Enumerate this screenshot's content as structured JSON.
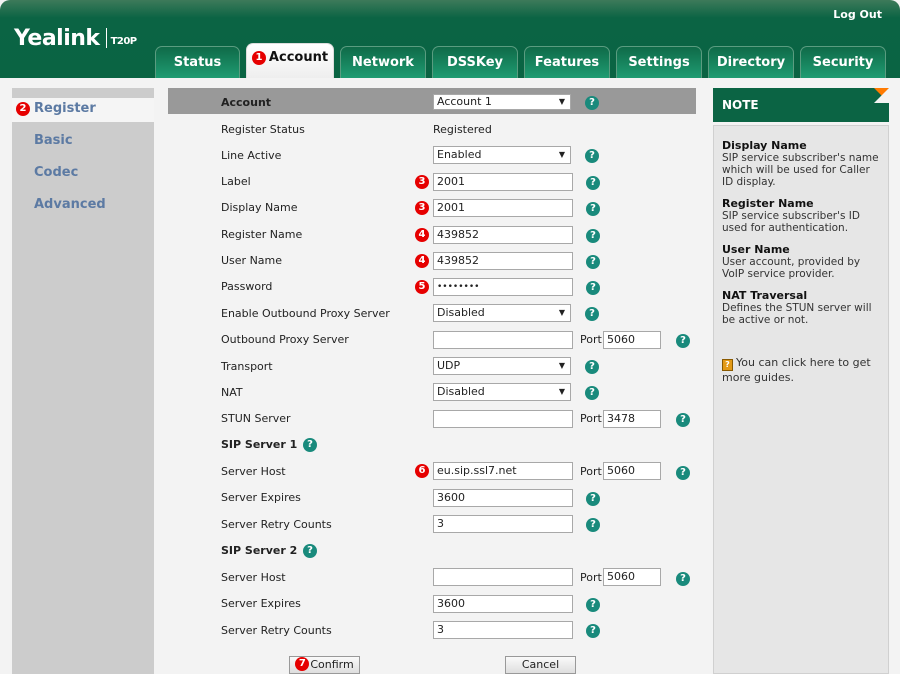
{
  "header": {
    "brand": "Yealink",
    "model": "T20P",
    "logout": "Log Out",
    "tabs": [
      {
        "label": "Status",
        "active": false
      },
      {
        "label": "Account",
        "active": true,
        "badge": "1"
      },
      {
        "label": "Network",
        "active": false
      },
      {
        "label": "DSSKey",
        "active": false
      },
      {
        "label": "Features",
        "active": false
      },
      {
        "label": "Settings",
        "active": false
      },
      {
        "label": "Directory",
        "active": false
      },
      {
        "label": "Security",
        "active": false
      }
    ]
  },
  "sidebar": {
    "items": [
      {
        "label": "Register",
        "active": true,
        "badge": "2"
      },
      {
        "label": "Basic",
        "active": false
      },
      {
        "label": "Codec",
        "active": false
      },
      {
        "label": "Advanced",
        "active": false
      }
    ]
  },
  "form": {
    "account": {
      "label": "Account",
      "value": "Account 1"
    },
    "register_status": {
      "label": "Register Status",
      "value": "Registered"
    },
    "line_active": {
      "label": "Line Active",
      "value": "Enabled"
    },
    "label": {
      "label": "Label",
      "value": "2001",
      "badge": "3"
    },
    "display_name": {
      "label": "Display Name",
      "value": "2001",
      "badge": "3"
    },
    "register_name": {
      "label": "Register Name",
      "value": "439852",
      "badge": "4"
    },
    "user_name": {
      "label": "User Name",
      "value": "439852",
      "badge": "4"
    },
    "password": {
      "label": "Password",
      "value": "••••••••",
      "badge": "5"
    },
    "enable_outbound": {
      "label": "Enable Outbound Proxy Server",
      "value": "Disabled"
    },
    "outbound_proxy": {
      "label": "Outbound Proxy Server",
      "value": "",
      "port_label": "Port",
      "port": "5060"
    },
    "transport": {
      "label": "Transport",
      "value": "UDP"
    },
    "nat": {
      "label": "NAT",
      "value": "Disabled"
    },
    "stun_server": {
      "label": "STUN Server",
      "value": "",
      "port_label": "Port",
      "port": "3478"
    },
    "sip1": {
      "title": "SIP Server 1",
      "host_label": "Server Host",
      "host": "eu.sip.ssl7.net",
      "host_badge": "6",
      "port_label": "Port",
      "port": "5060",
      "expires_label": "Server Expires",
      "expires": "3600",
      "retry_label": "Server Retry Counts",
      "retry": "3"
    },
    "sip2": {
      "title": "SIP Server 2",
      "host_label": "Server Host",
      "host": "",
      "port_label": "Port",
      "port": "5060",
      "expires_label": "Server Expires",
      "expires": "3600",
      "retry_label": "Server Retry Counts",
      "retry": "3"
    },
    "confirm_label": "Confirm",
    "confirm_badge": "7",
    "cancel_label": "Cancel",
    "help_glyph": "?"
  },
  "note": {
    "title": "NOTE",
    "items": [
      {
        "title": "Display Name",
        "text": "SIP service subscriber's name which will be used for Caller ID display."
      },
      {
        "title": "Register Name",
        "text": "SIP service subscriber's ID used for authentication."
      },
      {
        "title": "User Name",
        "text": "User account, provided by VoIP service provider."
      },
      {
        "title": "NAT Traversal",
        "text": "Defines the STUN server will be active or not."
      }
    ],
    "guide_icon": "?",
    "guide_text": "You can click here to get more guides."
  },
  "colors": {
    "brand_green": "#0b6444",
    "badge_red": "#e60000",
    "help_teal": "#198a7c",
    "note_fold": "#ff7a00",
    "sidebar_link": "#5c7aa3"
  }
}
